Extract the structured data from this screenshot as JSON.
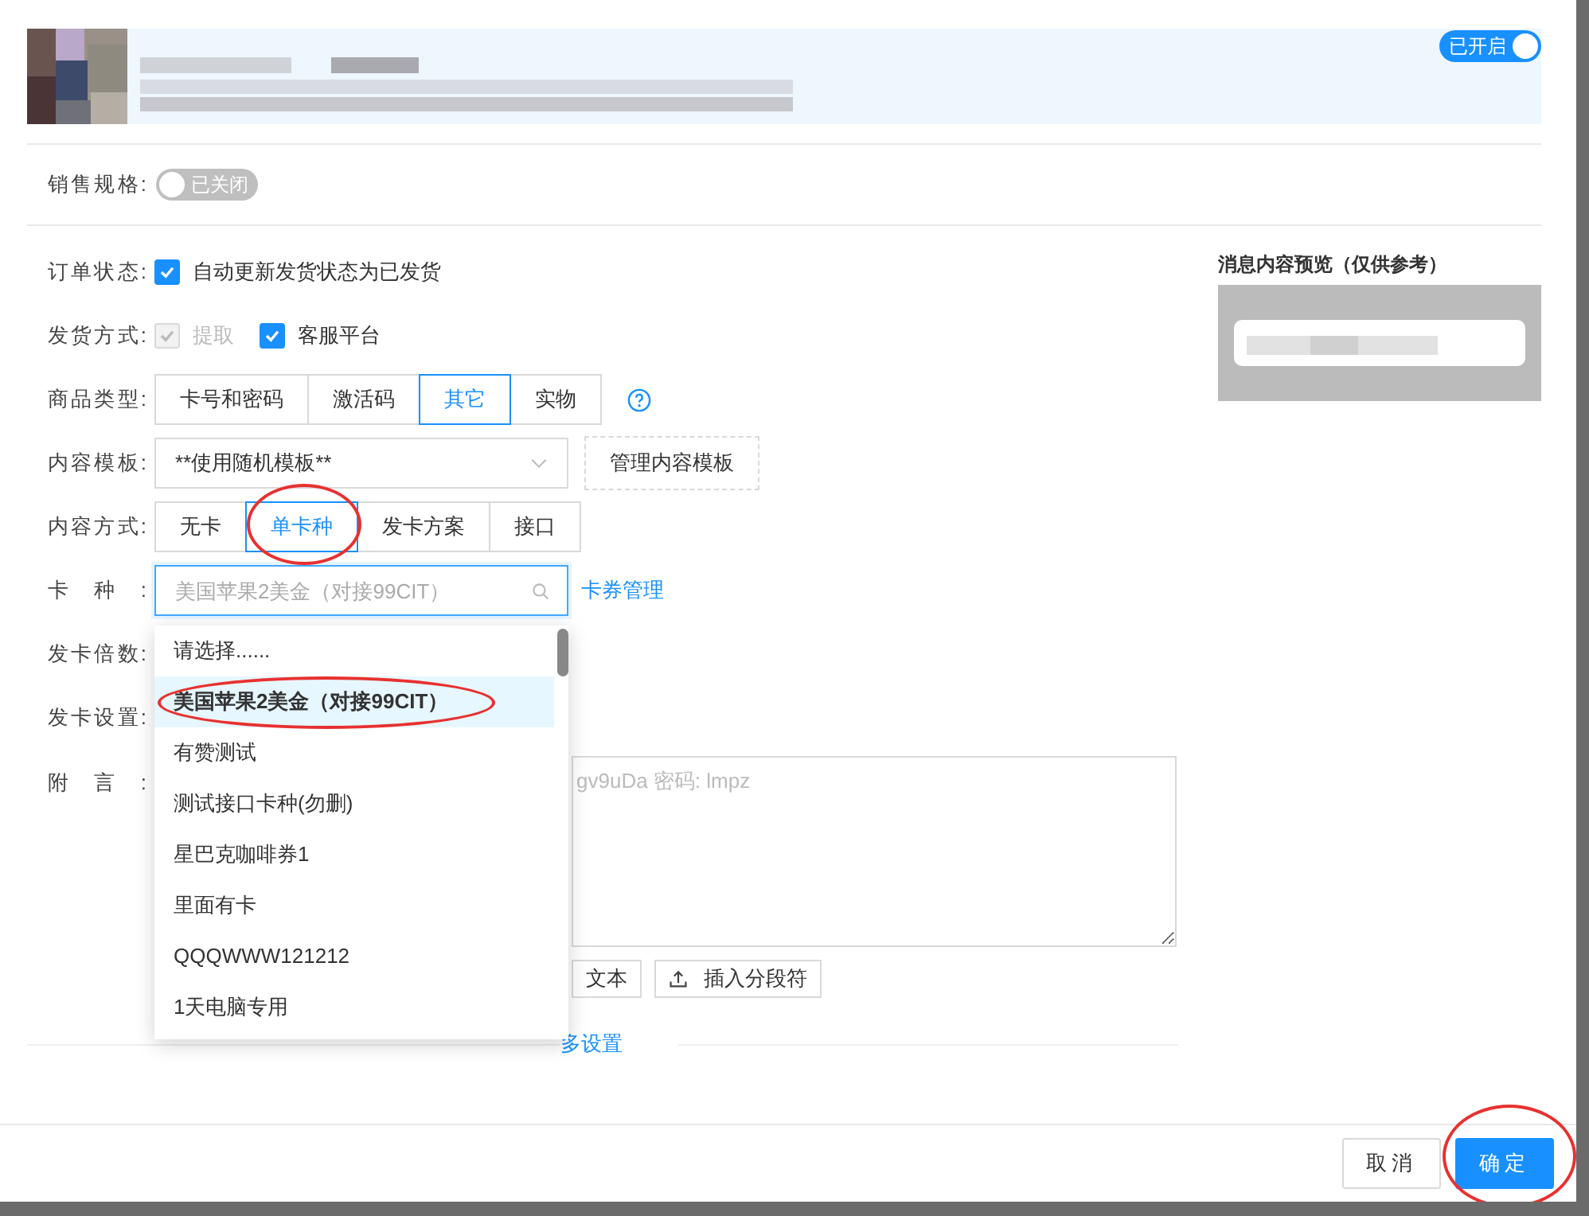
{
  "header": {
    "toggle": {
      "label": "已开启",
      "on": true
    }
  },
  "sale_spec": {
    "label": "销售规格:",
    "toggle": {
      "label": "已关闭",
      "on": false
    }
  },
  "form": [
    {
      "kind": "checks",
      "label": "订单状态:",
      "options": [
        {
          "label": "自动更新发货状态为已发货",
          "checked": true,
          "disabled": false
        }
      ]
    },
    {
      "kind": "checks",
      "label": "发货方式:",
      "options": [
        {
          "label": "提取",
          "checked": true,
          "disabled": true
        },
        {
          "label": "客服平台",
          "checked": true,
          "disabled": false
        }
      ]
    },
    {
      "kind": "segmented",
      "label": "商品类型:",
      "help": true,
      "options": [
        {
          "label": "卡号和密码",
          "selected": false,
          "circled": false
        },
        {
          "label": "激活码",
          "selected": false,
          "circled": false
        },
        {
          "label": "其它",
          "selected": true,
          "circled": false
        },
        {
          "label": "实物",
          "selected": false,
          "circled": false
        }
      ]
    },
    {
      "kind": "select",
      "label": "内容模板:",
      "value": "**使用随机模板**",
      "button": "管理内容模板"
    },
    {
      "kind": "segmented",
      "label": "内容方式:",
      "options": [
        {
          "label": "无卡",
          "selected": false,
          "circled": false
        },
        {
          "label": "单卡种",
          "selected": true,
          "circled": true
        },
        {
          "label": "发卡方案",
          "selected": false,
          "circled": false
        },
        {
          "label": "接口",
          "selected": false,
          "circled": false
        }
      ]
    },
    {
      "kind": "combo",
      "label": "卡种:",
      "placeholder": "美国苹果2美金（对接99CIT）",
      "link": "卡券管理"
    },
    {
      "kind": "blank",
      "label": "发卡倍数:"
    },
    {
      "kind": "blank",
      "label": "发卡设置:"
    },
    {
      "kind": "textarea",
      "label": "附言:",
      "placeholder": "gv9uDa 密码: lmpz",
      "buttons": [
        {
          "label": "文本",
          "icon": false
        },
        {
          "label": "插入分段符",
          "icon": true
        }
      ]
    }
  ],
  "more_link": "多设置",
  "preview": {
    "title": "消息内容预览（仅供参考）"
  },
  "dropdown": {
    "items": [
      {
        "label": "请选择......",
        "selected": false,
        "circled": false
      },
      {
        "label": "美国苹果2美金（对接99CIT）",
        "selected": true,
        "circled": true
      },
      {
        "label": "有赞测试",
        "selected": false,
        "circled": false
      },
      {
        "label": "测试接口卡种(勿删)",
        "selected": false,
        "circled": false
      },
      {
        "label": "星巴克咖啡券1",
        "selected": false,
        "circled": false
      },
      {
        "label": "里面有卡",
        "selected": false,
        "circled": false
      },
      {
        "label": "QQQWWW121212",
        "selected": false,
        "circled": false
      },
      {
        "label": "1天电脑专用",
        "selected": false,
        "circled": false
      }
    ]
  },
  "footer": {
    "buttons": [
      {
        "label": "取消",
        "primary": false,
        "circled": false
      },
      {
        "label": "确定",
        "primary": true,
        "circled": true
      }
    ]
  }
}
